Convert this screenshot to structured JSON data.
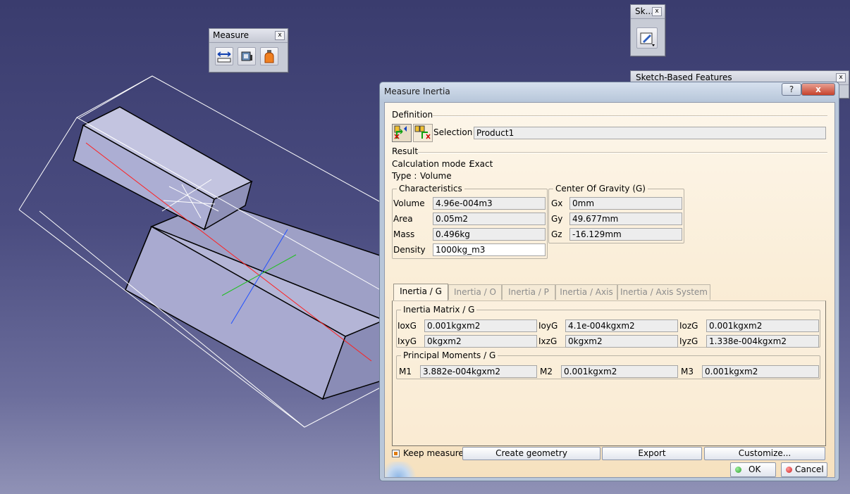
{
  "measure_toolbar": {
    "title": "Measure",
    "close": "x",
    "tools": [
      "measure-between-icon",
      "measure-item-icon",
      "measure-inertia-icon"
    ]
  },
  "sketch_toolbar": {
    "title": "Sk...",
    "close": "x",
    "tools": [
      "sketcher-icon"
    ]
  },
  "sbf_toolbar": {
    "title": "Sketch-Based Features",
    "close": "x"
  },
  "dialog": {
    "title": "Measure Inertia",
    "help": "?",
    "close": "x",
    "definition_label": "Definition",
    "selection_label": "Selection :",
    "selection_value": "Product1",
    "result_label": "Result",
    "calc_mode_label": "Calculation mode :",
    "calc_mode_value": "Exact",
    "type_label": "Type :",
    "type_value": "Volume",
    "characteristics": {
      "title": "Characteristics",
      "volume_label": "Volume",
      "volume": "4.96e-004m3",
      "area_label": "Area",
      "area": "0.05m2",
      "mass_label": "Mass",
      "mass": "0.496kg",
      "density_label": "Density",
      "density": "1000kg_m3"
    },
    "cog": {
      "title": "Center Of Gravity (G)",
      "gx_label": "Gx",
      "gx": "0mm",
      "gy_label": "Gy",
      "gy": "49.677mm",
      "gz_label": "Gz",
      "gz": "-16.129mm"
    },
    "tabs": [
      "Inertia / G",
      "Inertia / O",
      "Inertia / P",
      "Inertia / Axis",
      "Inertia / Axis System"
    ],
    "active_tab": "Inertia / G",
    "inertia_matrix": {
      "title": "Inertia Matrix / G",
      "ioxg_label": "IoxG",
      "ioxg": "0.001kgxm2",
      "ioyg_label": "IoyG",
      "ioyg": "4.1e-004kgxm2",
      "iozg_label": "IozG",
      "iozg": "0.001kgxm2",
      "ixyg_label": "IxyG",
      "ixyg": "0kgxm2",
      "ixzg_label": "IxzG",
      "ixzg": "0kgxm2",
      "iyzg_label": "IyzG",
      "iyzg": "1.338e-004kgxm2"
    },
    "principal_moments": {
      "title": "Principal Moments / G",
      "m1_label": "M1",
      "m1": "3.882e-004kgxm2",
      "m2_label": "M2",
      "m2": "0.001kgxm2",
      "m3_label": "M3",
      "m3": "0.001kgxm2"
    },
    "keep_measure_label": "Keep measure",
    "keep_measure_checked": true,
    "create_geometry": "Create geometry",
    "export": "Export",
    "customize": "Customize...",
    "ok": "OK",
    "cancel": "Cancel"
  },
  "colors": {
    "background": "#4a4c80",
    "part_face": "#b4b5d6",
    "axis_red": "#ff2020",
    "axis_green": "#20c020",
    "axis_blue": "#2050ff",
    "ok_green": "#2e9e2e",
    "cancel_red": "#d02020"
  }
}
